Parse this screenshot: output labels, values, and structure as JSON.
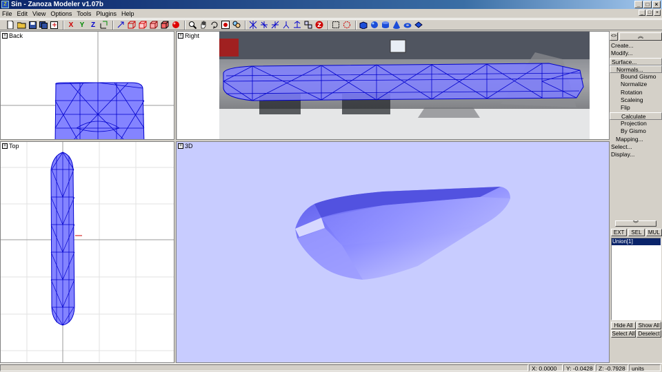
{
  "window": {
    "title": "Sin - Zanoza Modeler v1.07b",
    "controls": [
      "_",
      "□",
      "×"
    ]
  },
  "menu": [
    "File",
    "Edit",
    "View",
    "Options",
    "Tools",
    "Plugins",
    "Help"
  ],
  "toolbar": {
    "axis_x": "X",
    "axis_y": "Y",
    "axis_z": "Z"
  },
  "viewports": {
    "back": "Back",
    "right": "Right",
    "top": "Top",
    "perspective": "3D"
  },
  "panel": {
    "menu": [
      {
        "label": "Create...",
        "level": 0
      },
      {
        "label": "Modify...",
        "level": 0
      },
      {
        "label": "Surface...",
        "level": 0,
        "boxed": true
      },
      {
        "label": "Normals...",
        "level": 1,
        "boxed": true
      },
      {
        "label": "Bound Gismo",
        "level": 2
      },
      {
        "label": "Normalize",
        "level": 2
      },
      {
        "label": "Rotation",
        "level": 2
      },
      {
        "label": "Scaleing",
        "level": 2
      },
      {
        "label": "Flip",
        "level": 2
      },
      {
        "label": "Calculate",
        "level": 2,
        "boxed": true
      },
      {
        "label": "Projection",
        "level": 2
      },
      {
        "label": "By Gismo",
        "level": 2
      },
      {
        "label": "Mapping...",
        "level": 1
      },
      {
        "label": "Select...",
        "level": 0
      },
      {
        "label": "Display...",
        "level": 0
      }
    ],
    "tabs": [
      "EXT",
      "SEL",
      "MUL"
    ],
    "objects": [
      "Union[1]"
    ],
    "buttons": [
      "Hide All",
      "Show All",
      "Select All",
      "Deselect"
    ]
  },
  "status": {
    "x": "X: 0.0000",
    "y": "Y: -0.0428",
    "z": "Z: -0.7928",
    "units": "units"
  },
  "colors": {
    "mesh_fill": "#7f7fff",
    "mesh_wire": "#0000cc",
    "viewport_3d_bg": "#c8ccff",
    "selection": "#0a246a"
  }
}
